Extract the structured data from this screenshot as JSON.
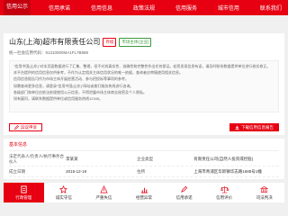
{
  "nav": [
    "信用公示",
    "信用承诺",
    "信用信息",
    "政策法规",
    "信用服务",
    "城市信用",
    "联系我们"
  ],
  "company": {
    "name": "山东(上海)超市有限责任公司",
    "tag_status": "存续",
    "tag_type": "市场主体(企业)",
    "credit_code": "统一社会信用代码：91310000MA1FL7B888"
  },
  "description": [
    "“信用中国(山东)”对本页面数据进行了汇集、整理，但不对其真实性、准确性和完整性作出任何保证。若您发现信息有误，请及时联系数据提供单位进行核实修正。",
    "本平台提供的信用信息仅供参考，不作为认定相关主体信用状况的唯一依据，查询者应审慎使用相关信息。",
    "信用信息报告可作为市场主体开展经营活动、参与招投标等事项的参考。",
    "如需查询更多信息，请登录“信用中国(山东)”网站或拨打服务热线进行咨询。",
    "各级部门和单位应依法依规使用公示信息，不得泄露市场主体商业秘密及个人隐私。",
    "如有疑问，请联系数据提供单位或信用服务热线12345。"
  ],
  "buttons": {
    "left": "异议申诉",
    "right": "下载信用信息报告"
  },
  "basic_info": {
    "title": "基本信息",
    "rows": [
      {
        "l1": "法定代表人/负责人/执行事务合伙人",
        "v1": "李某某",
        "l2": "企业类型",
        "v2": "有限责任公司(自然人投资或控股)"
      },
      {
        "l1": "成立日期",
        "v1": "2015-12-19",
        "l2": "住所",
        "v2": "上海市青浦区华新镇华志路1688号1幢"
      }
    ]
  },
  "tabs": [
    {
      "label": "行政管理",
      "icon": "document-icon"
    },
    {
      "label": "诚实守信",
      "icon": "star-icon"
    },
    {
      "label": "严重失信",
      "icon": "alert-icon"
    },
    {
      "label": "经营异常",
      "icon": "chart-icon"
    },
    {
      "label": "信用承诺",
      "icon": "pen-icon"
    },
    {
      "label": "信用评价",
      "icon": "scale-icon"
    },
    {
      "label": "司法判决",
      "icon": "building-icon"
    }
  ]
}
